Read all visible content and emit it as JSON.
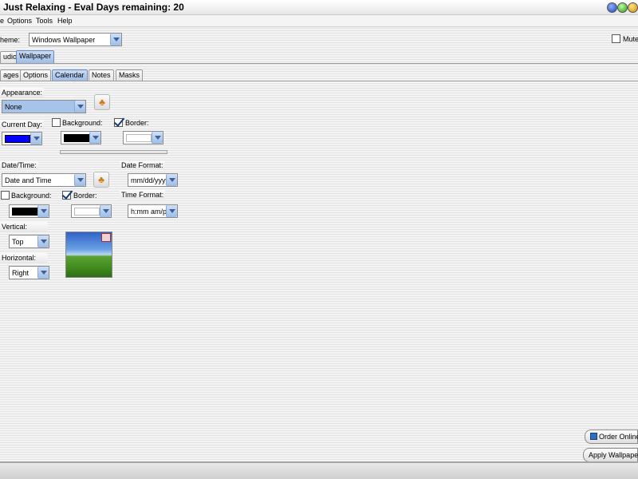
{
  "window": {
    "title": "Just Relaxing - Eval Days remaining: 20"
  },
  "menu": [
    "e",
    "Options",
    "Tools",
    "Help"
  ],
  "theme": {
    "label": "heme:",
    "value": "Windows Wallpaper"
  },
  "mute_label": "Mute",
  "main_tabs": [
    "udio",
    "Wallpaper"
  ],
  "sub_tabs": [
    "ages",
    "Options",
    "Calendar",
    "Notes",
    "Masks"
  ],
  "calendar": {
    "appearance_label": "Appearance:",
    "appearance_value": "None",
    "current_day_label": "Current Day:",
    "current_day_color": "#0000ff",
    "background_label": "Background:",
    "background_checked": false,
    "background_color": "#000000",
    "border_label": "Border:",
    "border_checked": true,
    "border_color": "#ffffff"
  },
  "datetime": {
    "label": "Date/Time:",
    "value": "Date and Time",
    "date_format_label": "Date Format:",
    "date_format_value": "mm/dd/yyyy",
    "background_label": "Background:",
    "background_checked": false,
    "background_color": "#000000",
    "border_label": "Border:",
    "border_checked": true,
    "border_color": "#ffffff",
    "time_format_label": "Time Format:",
    "time_format_value": "h:mm am/pm",
    "vertical_label": "Vertical:",
    "vertical_value": "Top",
    "horizontal_label": "Horizontal:",
    "horizontal_value": "Right"
  },
  "buttons": {
    "order_online": "Order Online",
    "apply_wallpaper": "Apply Wallpaper"
  }
}
